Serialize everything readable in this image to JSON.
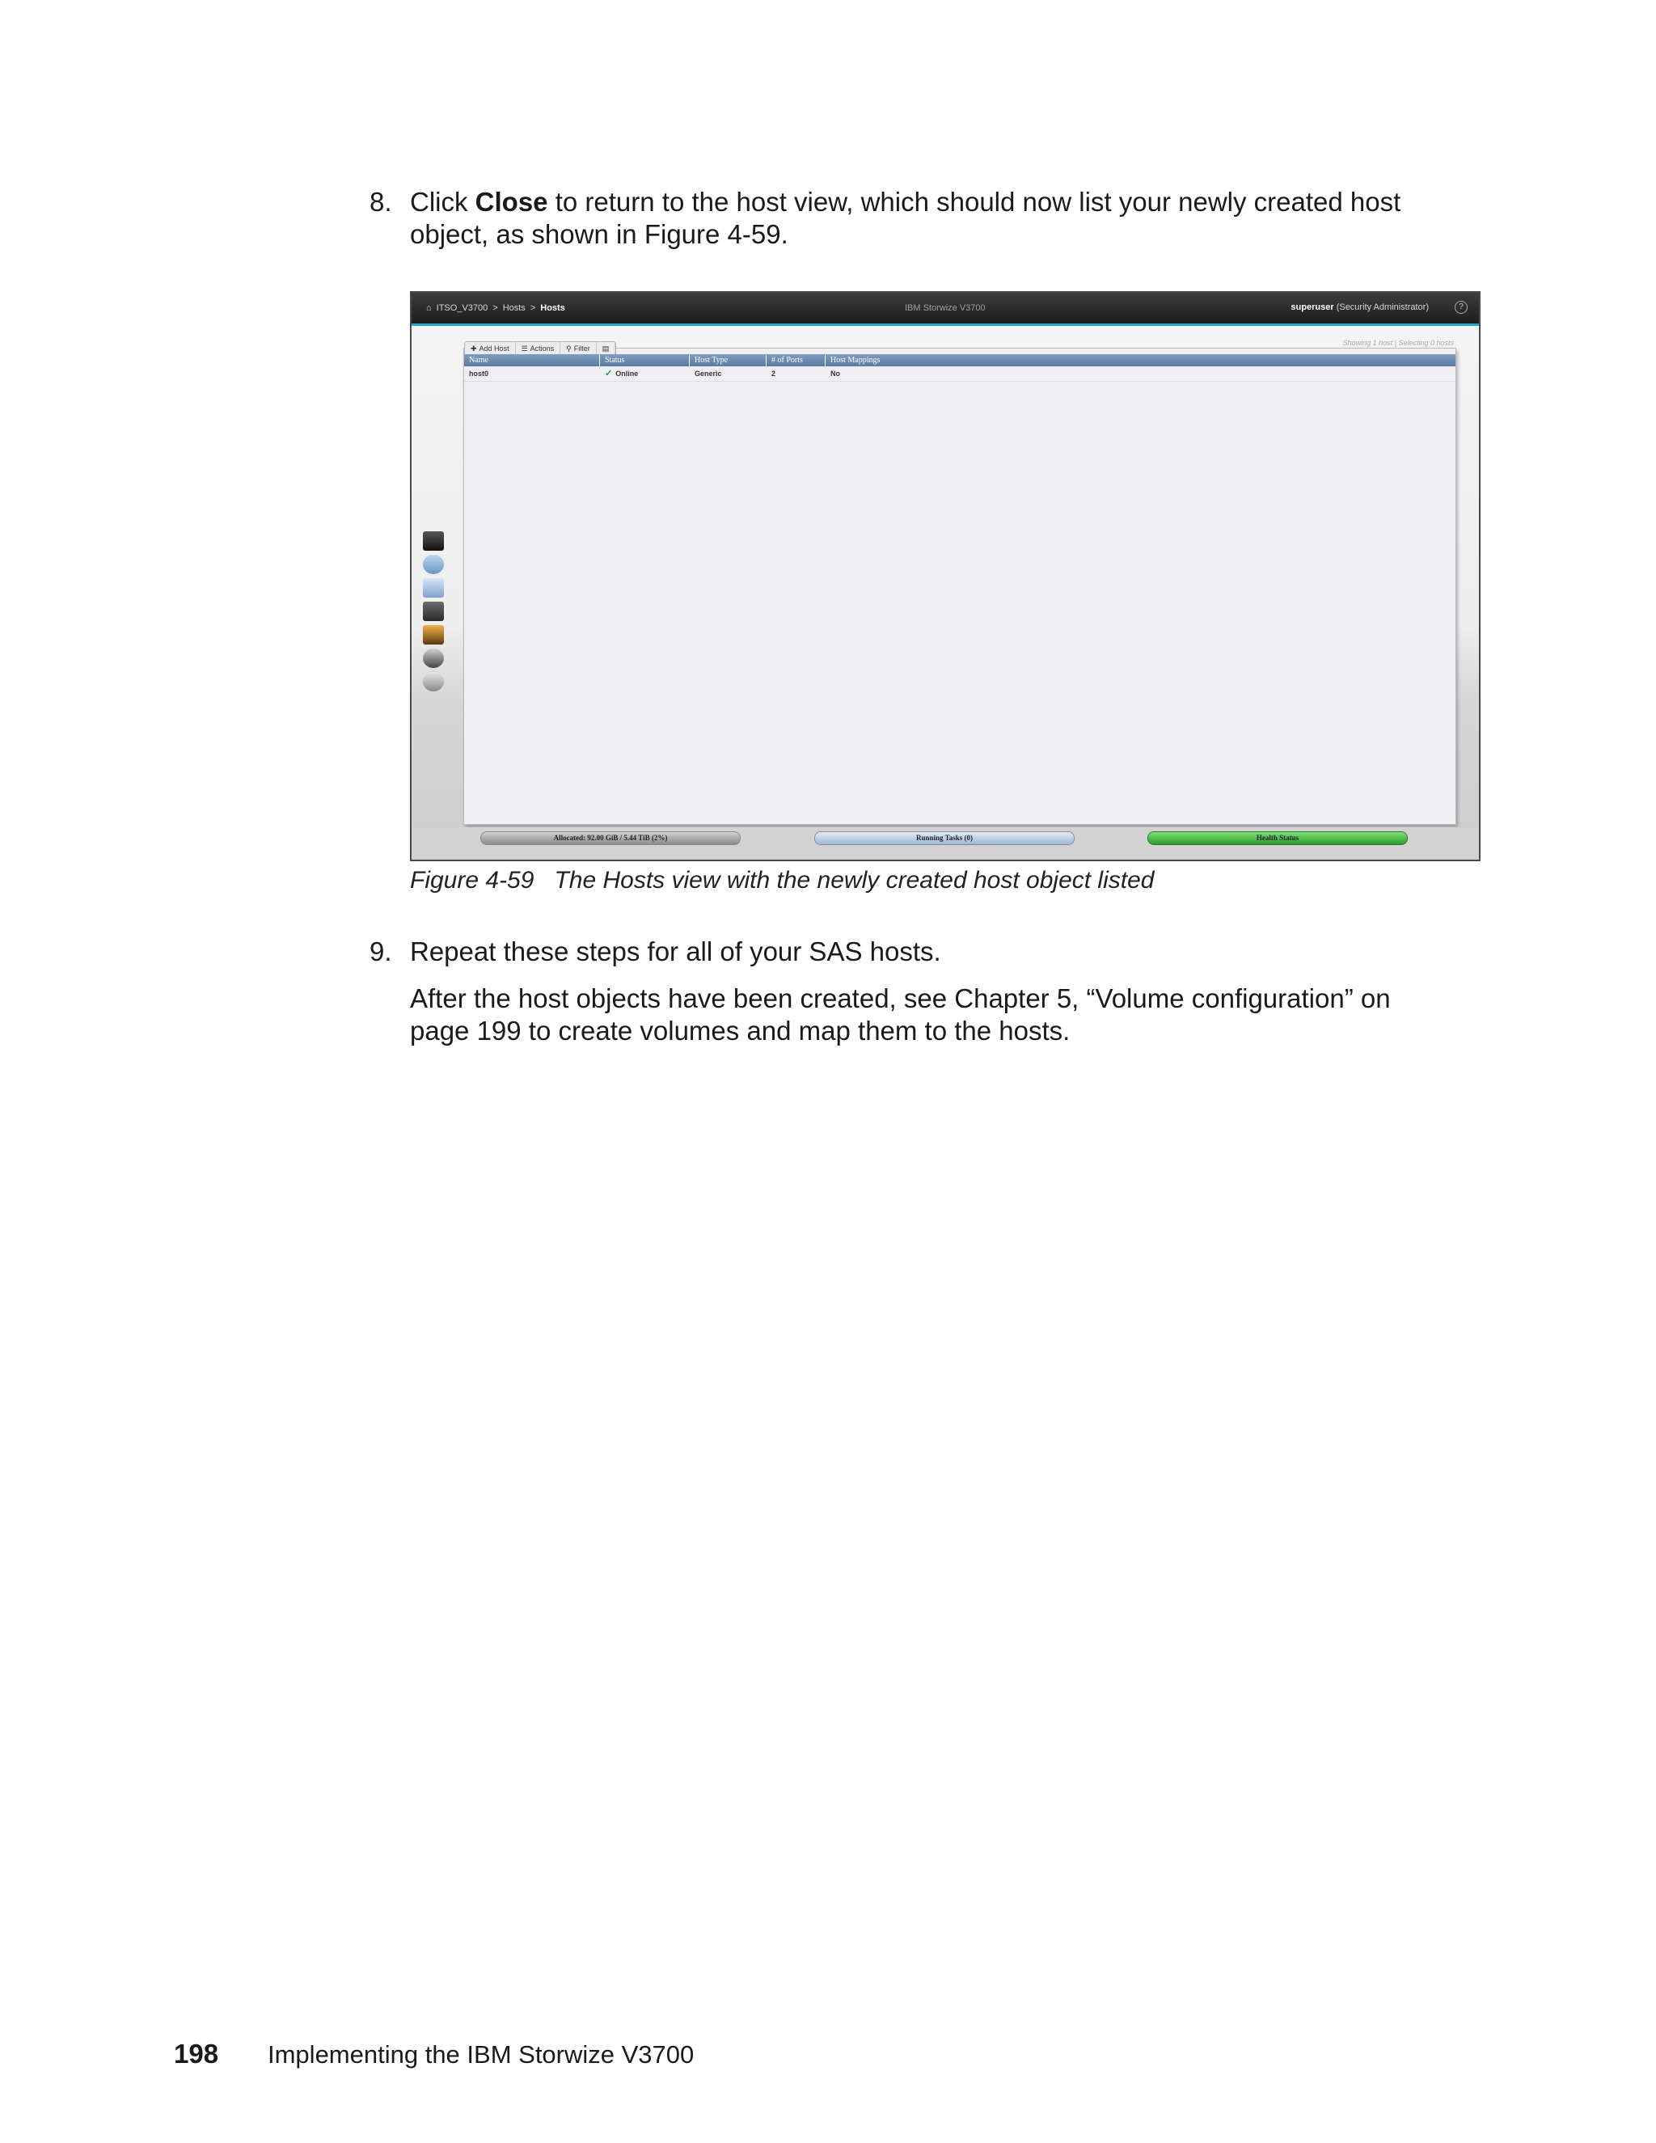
{
  "step8": {
    "number": "8.",
    "text_before": "Click ",
    "bold": "Close",
    "text_after": " to return to the host view, which should now list your newly created host object, as shown in Figure 4-59."
  },
  "screenshot": {
    "breadcrumb": [
      "ITSO_V3700",
      ">",
      "Hosts",
      ">",
      "Hosts"
    ],
    "product": "IBM Storwize V3700",
    "user_name": "superuser",
    "user_role": "(Security Administrator)",
    "help": "?",
    "toolbar": {
      "add_host": "Add Host",
      "actions": "Actions",
      "filter": "Filter"
    },
    "showing": "Showing 1 host | Selecting 0 hosts",
    "columns": [
      "Name",
      "Status",
      "Host Type",
      "# of Ports",
      "Host Mappings"
    ],
    "rows": [
      {
        "name": "host0",
        "status": "Online",
        "host_type": "Generic",
        "ports": "2",
        "mappings": "No"
      }
    ],
    "status_pills": {
      "allocated": "Allocated: 92.00 GiB / 5.44 TiB (2%)",
      "running": "Running Tasks (0)",
      "health": "Health Status"
    }
  },
  "caption": {
    "label": "Figure 4-59",
    "text": "The Hosts view with the newly created host object listed"
  },
  "step9": {
    "number": "9.",
    "line1": "Repeat these steps for all of your SAS hosts.",
    "para": "After the host objects have been created, see Chapter 5, “Volume configuration” on page 199 to create volumes and map them to the hosts."
  },
  "footer": {
    "page": "198",
    "title": "Implementing the IBM Storwize V3700"
  }
}
